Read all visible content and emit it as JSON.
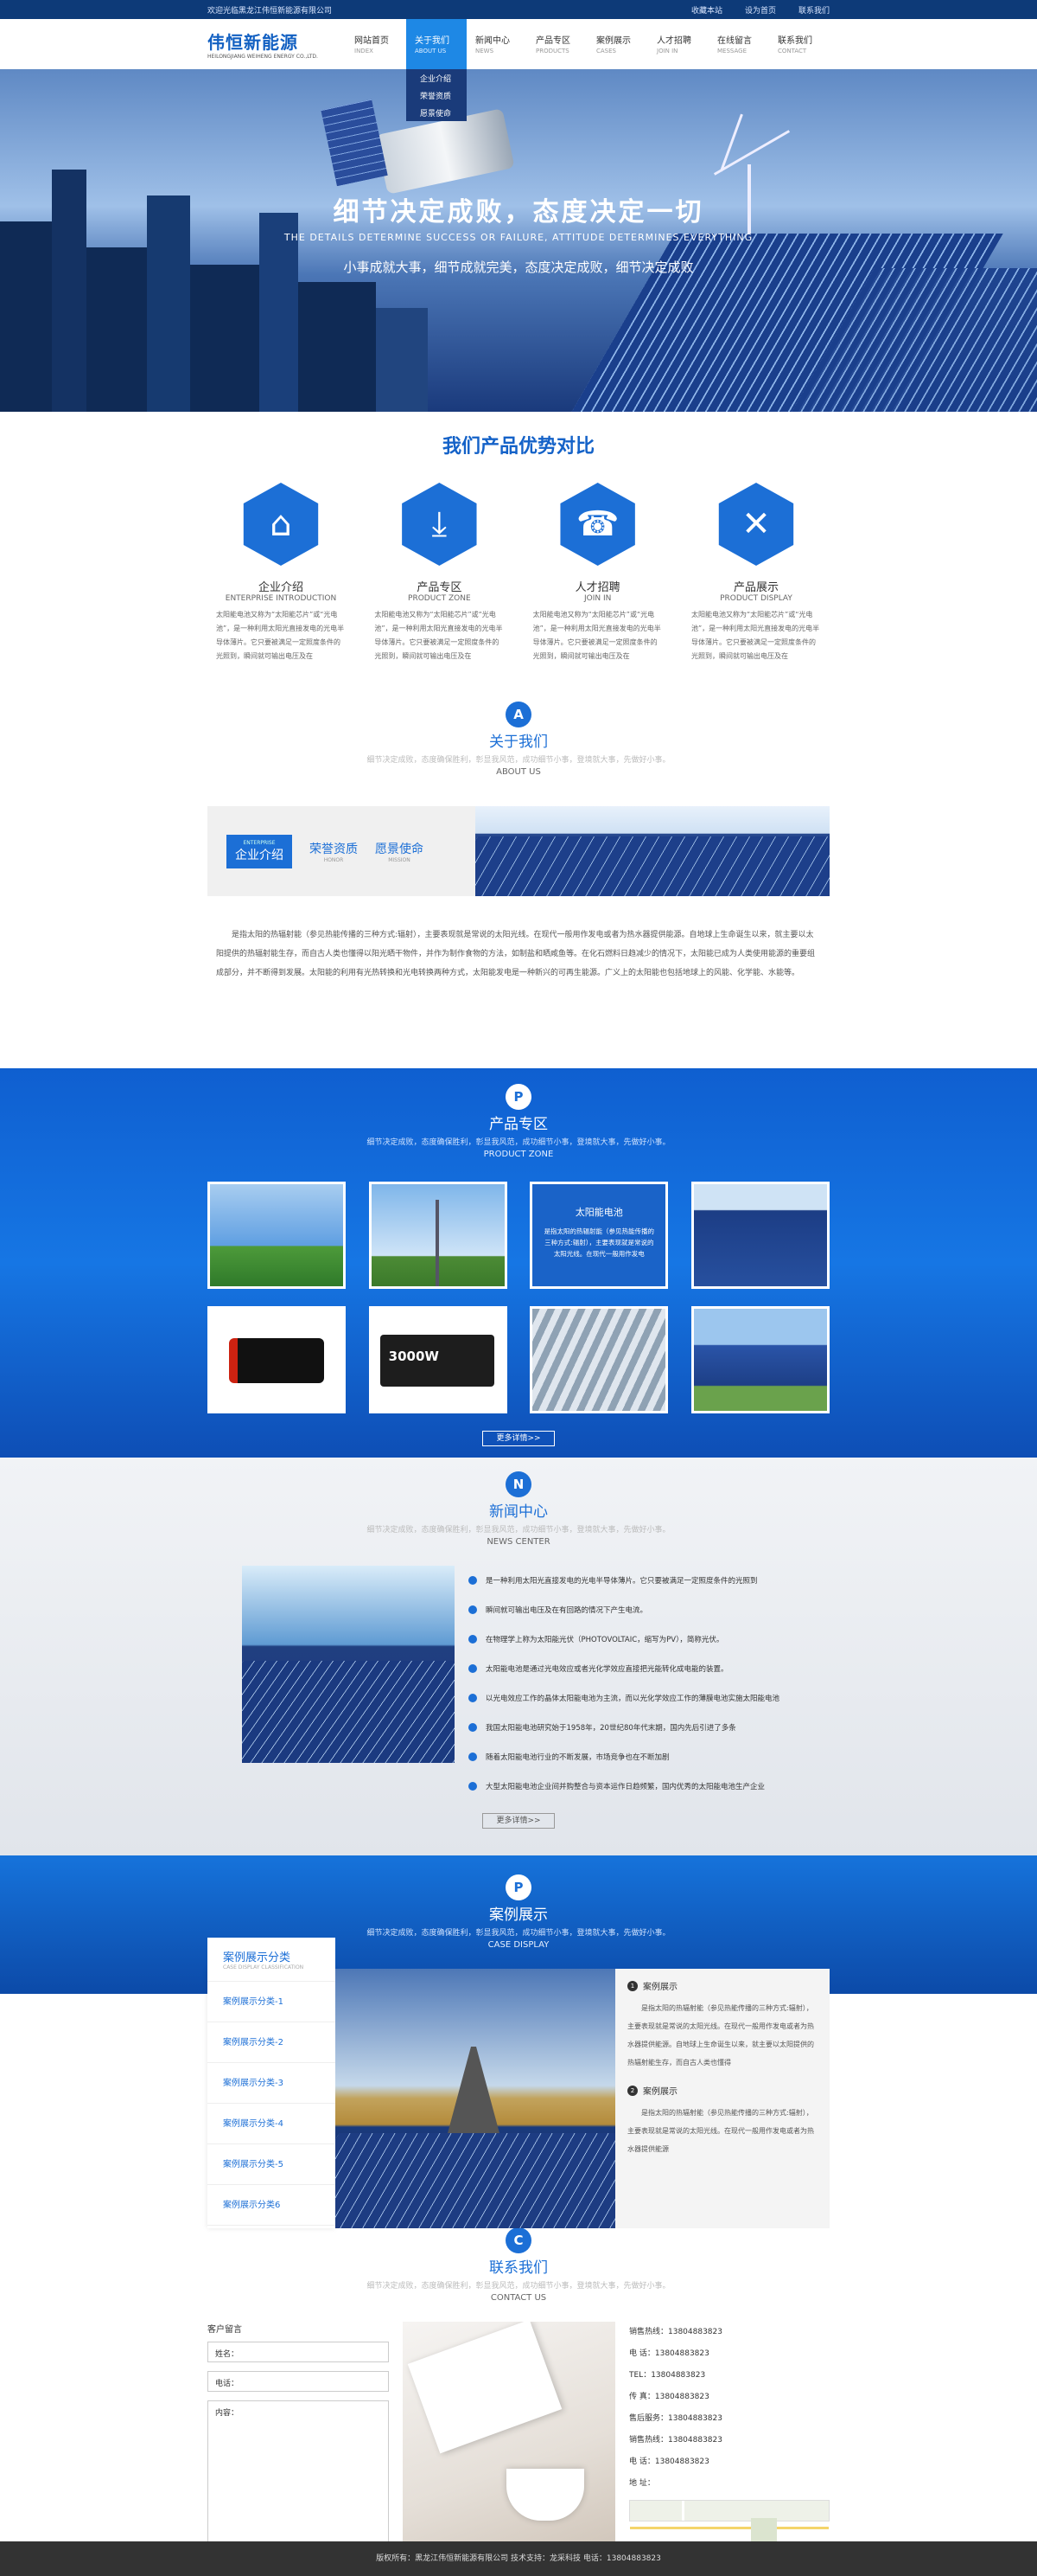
{
  "topbar": {
    "welcome": "欢迎光临黑龙江伟恒新能源有限公司",
    "links": [
      "收藏本站",
      "设为首页",
      "联系我们"
    ]
  },
  "logo": {
    "cn": "伟恒新能源",
    "en": "HEILONGJIANG WEIHENG ENERGY CO.,LTD."
  },
  "nav": [
    {
      "cn": "网站首页",
      "en": "INDEX"
    },
    {
      "cn": "关于我们",
      "en": "ABOUT US"
    },
    {
      "cn": "新闻中心",
      "en": "NEWS"
    },
    {
      "cn": "产品专区",
      "en": "PRODUCTS"
    },
    {
      "cn": "案例展示",
      "en": "CASES"
    },
    {
      "cn": "人才招聘",
      "en": "JOIN IN"
    },
    {
      "cn": "在线留言",
      "en": "MESSAGE"
    },
    {
      "cn": "联系我们",
      "en": "CONTACT"
    }
  ],
  "dropdown": [
    "企业介绍",
    "荣誉资质",
    "愿景使命"
  ],
  "banner": {
    "title": "细节决定成败，态度决定一切",
    "en": "THE DETAILS DETERMINE SUCCESS OR FAILURE, ATTITUDE DETERMINES EVERYTHING",
    "sub": "小事成就大事，细节成就完美，态度决定成败，细节决定成败"
  },
  "advantages": {
    "title": "我们产品优势对比",
    "items": [
      {
        "cn": "企业介绍",
        "en": "ENTERPRISE INTRODUCTION",
        "icon": "house-icon",
        "desc": "太阳能电池又称为“太阳能芯片”或“光电池”，是一种利用太阳光直接发电的光电半导体薄片。它只要被满足一定照度条件的光照到，瞬间就可输出电压及在"
      },
      {
        "cn": "产品专区",
        "en": "PRODUCT ZONE",
        "icon": "download-icon",
        "desc": "太阳能电池又称为“太阳能芯片”或“光电池”，是一种利用太阳光直接发电的光电半导体薄片。它只要被满足一定照度条件的光照到，瞬间就可输出电压及在"
      },
      {
        "cn": "人才招聘",
        "en": "JOIN IN",
        "icon": "headset-icon",
        "desc": "太阳能电池又称为“太阳能芯片”或“光电池”，是一种利用太阳光直接发电的光电半导体薄片。它只要被满足一定照度条件的光照到，瞬间就可输出电压及在"
      },
      {
        "cn": "产品展示",
        "en": "PRODUCT DISPLAY",
        "icon": "tools-icon",
        "desc": "太阳能电池又称为“太阳能芯片”或“光电池”，是一种利用太阳光直接发电的光电半导体薄片。它只要被满足一定照度条件的光照到，瞬间就可输出电压及在"
      }
    ]
  },
  "about": {
    "badge": "A",
    "title": "关于我们",
    "slogan": "细节决定成败，态度确保胜利，彰显我风范，成功细节小事，登境就大事，先做好小事。",
    "en": "ABOUT  US",
    "tabs": [
      {
        "cn": "企业介绍",
        "en": "ENTERPRISE"
      },
      {
        "cn": "荣誉资质",
        "en": "HONOR"
      },
      {
        "cn": "愿景使命",
        "en": "MISSION"
      }
    ],
    "text": "是指太阳的热辐射能（参见热能传播的三种方式:辐射），主要表现就是常说的太阳光线。在现代一般用作发电或者为热水器提供能源。自地球上生命诞生以来，就主要以太阳提供的热辐射能生存，而自古人类也懂得以阳光晒干物件，并作为制作食物的方法，如制盐和晒咸鱼等。在化石燃料日趋减少的情况下，太阳能已成为人类使用能源的重要组成部分，并不断得到发展。太阳能的利用有光热转换和光电转换两种方式，太阳能发电是一种新兴的可再生能源。广义上的太阳能也包括地球上的风能、化学能、水能等。"
  },
  "product": {
    "badge": "P",
    "title": "产品专区",
    "slogan": "细节决定成败，态度确保胜利，彰显我风范，成功细节小事，登境就大事，先做好小事。",
    "en": "PRODUCT ZONE",
    "overlay_title": "太阳能电池",
    "overlay_text": "是指太阳的热辐射能（参见热能传播的三种方式:辐射），主要表现就是常说的太阳光线。在现代一般用作发电",
    "inverter_label": "3000W",
    "more": "更多详情>>"
  },
  "news": {
    "badge": "N",
    "title": "新闻中心",
    "slogan": "细节决定成败，态度确保胜利，彰显我风范，成功细节小事，登境就大事，先做好小事。",
    "en": "NEWS CENTER",
    "items": [
      "是一种利用太阳光直接发电的光电半导体薄片。它只要被满足一定照度条件的光照到",
      "瞬间就可输出电压及在有回路的情况下产生电流。",
      "在物理学上称为太阳能光伏（PHOTOVOLTAIC，缩写为PV），简称光伏。",
      "太阳能电池是通过光电效应或者光化学效应直接把光能转化成电能的装置。",
      "以光电效应工作的晶体太阳能电池为主流，而以光化学效应工作的薄膜电池实施太阳能电池",
      "我国太阳能电池研究始于1958年，20世纪80年代末期，国内先后引进了多条",
      "随着太阳能电池行业的不断发展，市场竞争也在不断加剧",
      "大型太阳能电池企业间并购整合与资本运作日趋频繁，国内优秀的太阳能电池生产企业"
    ],
    "more": "更多详情>>"
  },
  "case": {
    "badge": "P",
    "title": "案例展示",
    "slogan": "细节决定成败，态度确保胜利，彰显我风范，成功细节小事，登境就大事，先做好小事。",
    "en": "CASE DISPLAY",
    "menu_title": "案例展示分类",
    "menu_en": "CASE DISPLAY CLASSIFICATION",
    "menu": [
      "案例展示分类-1",
      "案例展示分类-2",
      "案例展示分类-3",
      "案例展示分类-4",
      "案例展示分类-5",
      "案例展示分类6"
    ],
    "blocks": [
      {
        "num": "1",
        "title": "案例展示",
        "text": "是指太阳的热辐射能（参见热能传播的三种方式:辐射），主要表现就是常说的太阳光线。在现代一般用作发电或者为热水器提供能源。自地球上生命诞生以来，就主要以太阳提供的热辐射能生存，而自古人类也懂得"
      },
      {
        "num": "2",
        "title": "案例展示",
        "text": "是指太阳的热辐射能（参见热能传播的三种方式:辐射），主要表现就是常说的太阳光线。在现代一般用作发电或者为热水器提供能源"
      }
    ]
  },
  "contact": {
    "badge": "C",
    "title": "联系我们",
    "slogan": "细节决定成败，态度确保胜利，彰显我风范，成功细节小事，登境就大事，先做好小事。",
    "en": "CONTACT US",
    "form_title": "客户留言",
    "name_placeholder": "姓名：",
    "phone_placeholder": "电话：",
    "content_placeholder": "内容：",
    "info": [
      "销售热线：13804883823",
      "电   话：13804883823",
      "TEL：13804883823",
      "传   真：13804883823",
      "售后服务：13804883823",
      "销售热线：13804883823",
      "电   话：13804883823",
      "地   址："
    ]
  },
  "footer": "版权所有：黑龙江伟恒新能源有限公司        技术支持：龙采科技        电话：13804883823",
  "colors": {
    "primary": "#1c6fd6",
    "dark_nav": "#0d3a78",
    "footer": "#333333"
  }
}
